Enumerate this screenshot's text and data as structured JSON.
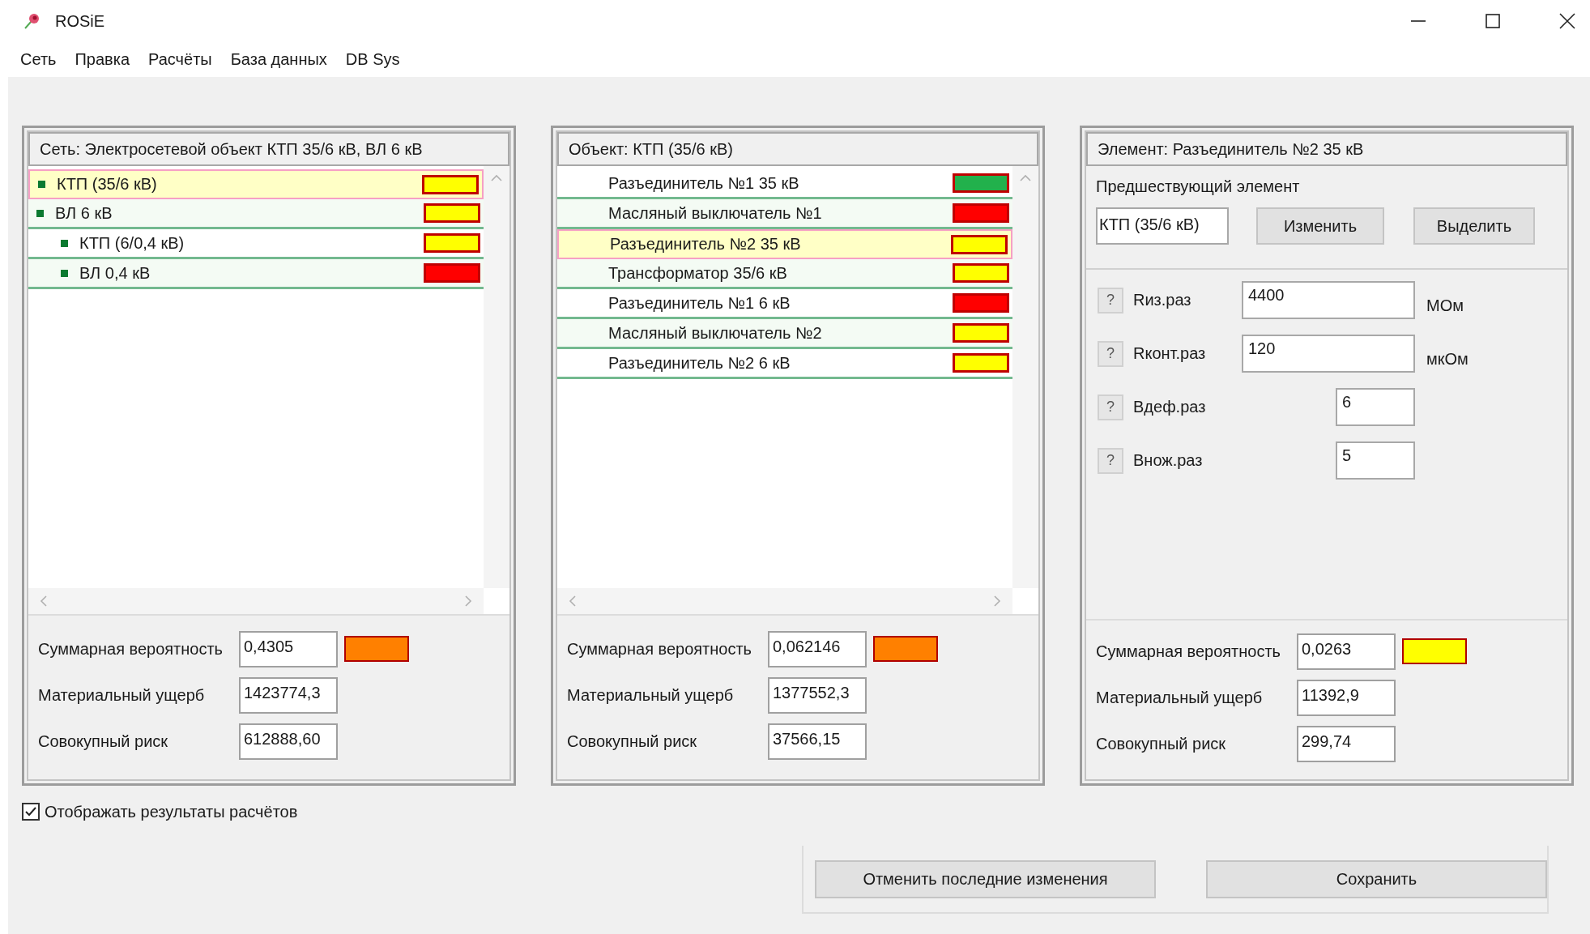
{
  "window": {
    "title": "ROSiE"
  },
  "menu": [
    "Сеть",
    "Правка",
    "Расчёты",
    "База данных",
    "DB Sys"
  ],
  "network_panel": {
    "title": "Сеть: Электросетевой объект КТП 35/6 кВ, ВЛ 6 кВ",
    "items": [
      {
        "label": "КТП (35/6 кВ)",
        "color": "#ffff00",
        "selected": true
      },
      {
        "label": "ВЛ 6 кВ",
        "color": "#ffff00",
        "selected": false,
        "children": [
          {
            "label": "КТП (6/0,4 кВ)",
            "color": "#ffff00",
            "selected": false
          },
          {
            "label": "ВЛ 0,4 кВ",
            "color": "#ff0000",
            "selected": false
          }
        ]
      }
    ],
    "summary": [
      {
        "label": "Суммарная вероятность",
        "value": "0,4305",
        "color": "#ff8000"
      },
      {
        "label": "Материальный ущерб",
        "value": "1423774,3"
      },
      {
        "label": "Совокупный риск",
        "value": "612888,60"
      }
    ]
  },
  "object_panel": {
    "title": "Объект: КТП (35/6 кВ)",
    "items": [
      {
        "label": "Разъединитель №1 35 кВ",
        "color": "#22b14c",
        "selected": false
      },
      {
        "label": "Масляный выключатель №1",
        "color": "#ff0000",
        "selected": false
      },
      {
        "label": "Разъединитель №2 35 кВ",
        "color": "#ffff00",
        "selected": true
      },
      {
        "label": "Трансформатор 35/6 кВ",
        "color": "#ffff00",
        "selected": false
      },
      {
        "label": "Разъединитель №1 6 кВ",
        "color": "#ff0000",
        "selected": false
      },
      {
        "label": "Масляный выключатель №2",
        "color": "#ffff00",
        "selected": false
      },
      {
        "label": "Разъединитель №2 6 кВ",
        "color": "#ffff00",
        "selected": false
      }
    ],
    "summary": [
      {
        "label": "Суммарная вероятность",
        "value": "0,062146",
        "color": "#ff8000"
      },
      {
        "label": "Материальный ущерб",
        "value": "1377552,3"
      },
      {
        "label": "Совокупный риск",
        "value": "37566,15"
      }
    ]
  },
  "element_panel": {
    "title": "Элемент: Разъединитель №2 35 кВ",
    "predecessor": {
      "label": "Предшествующий элемент",
      "value": "КТП (35/6 кВ)",
      "buttons": [
        "Изменить",
        "Выделить"
      ]
    },
    "parameters": [
      {
        "help": "?",
        "label": "Rиз.раз",
        "value": "4400",
        "unit": "МОм"
      },
      {
        "help": "?",
        "label": "Rконт.раз",
        "value": "120",
        "unit": "мкОм"
      },
      {
        "help": "?",
        "label": "Bдеф.раз",
        "value": "6"
      },
      {
        "help": "?",
        "label": "Bнож.раз",
        "value": "5"
      }
    ],
    "summary": [
      {
        "label": "Суммарная вероятность",
        "value": "0,0263",
        "color": "#ffff00"
      },
      {
        "label": "Материальный ущерб",
        "value": "11392,9"
      },
      {
        "label": "Совокупный риск",
        "value": "299,74"
      }
    ]
  },
  "show_results": {
    "label": "Отображать результаты расчётов",
    "checked": true
  },
  "buttons": [
    "Отменить последние изменения",
    "Сохранить"
  ]
}
